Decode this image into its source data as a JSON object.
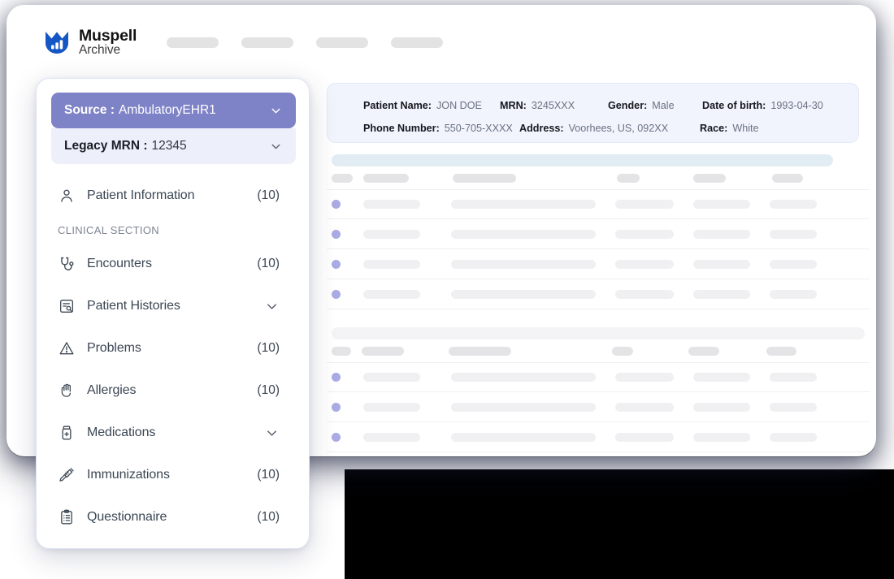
{
  "brand": {
    "name": "Muspell",
    "sub": "Archive",
    "logo_color": "#1456c4",
    "icon": "bar-chart-m-logo"
  },
  "topnav": {
    "placeholder_count": 4
  },
  "patient_header": {
    "rows": [
      [
        {
          "label": "Patient Name:",
          "value": "JON DOE"
        },
        {
          "label": "MRN:",
          "value": "3245XXX"
        },
        {
          "label": "Gender:",
          "value": "Male"
        },
        {
          "label": "Date of birth:",
          "value": "1993-04-30"
        }
      ],
      [
        {
          "label": "Phone Number:",
          "value": "550-705-XXXX"
        },
        {
          "label": "Address:",
          "value": "Voorhees, US, 092XX"
        },
        {
          "label": "Race:",
          "value": "White"
        }
      ]
    ]
  },
  "sidebar": {
    "source": {
      "label": "Source :",
      "value": "AmbulatoryEHR1",
      "icon": "chevron-down-icon",
      "accent": "#7e82c6"
    },
    "legacy_mrn": {
      "label": "Legacy MRN :",
      "value": "12345",
      "icon": "chevron-down-icon"
    },
    "section_title": "CLINICAL SECTION",
    "items_top": [
      {
        "label": "Patient Information",
        "count": "(10)",
        "icon": "person-icon",
        "type": "count"
      }
    ],
    "items_clinical": [
      {
        "label": "Encounters",
        "count": "(10)",
        "icon": "stethoscope-icon",
        "type": "count"
      },
      {
        "label": "Patient Histories",
        "count": "",
        "icon": "document-search-icon",
        "type": "expand"
      },
      {
        "label": "Problems",
        "count": "(10)",
        "icon": "warning-icon",
        "type": "count"
      },
      {
        "label": "Allergies",
        "count": "(10)",
        "icon": "hand-icon",
        "type": "count"
      },
      {
        "label": "Medications",
        "count": "",
        "icon": "pill-bottle-icon",
        "type": "expand"
      },
      {
        "label": "Immunizations",
        "count": "(10)",
        "icon": "syringe-icon",
        "type": "count"
      },
      {
        "label": "Questionnaire",
        "count": "(10)",
        "icon": "clipboard-icon",
        "type": "count"
      }
    ]
  },
  "content": {
    "loading": true,
    "tables": [
      {
        "title_bar_color": "#e2edf3",
        "columns": 6,
        "rows": 4
      },
      {
        "title_bar_color": "#f4f4f6",
        "columns": 6,
        "rows": 4
      }
    ],
    "dot_color": "#aaaae4",
    "skeleton_color": "#e4e4e6"
  }
}
